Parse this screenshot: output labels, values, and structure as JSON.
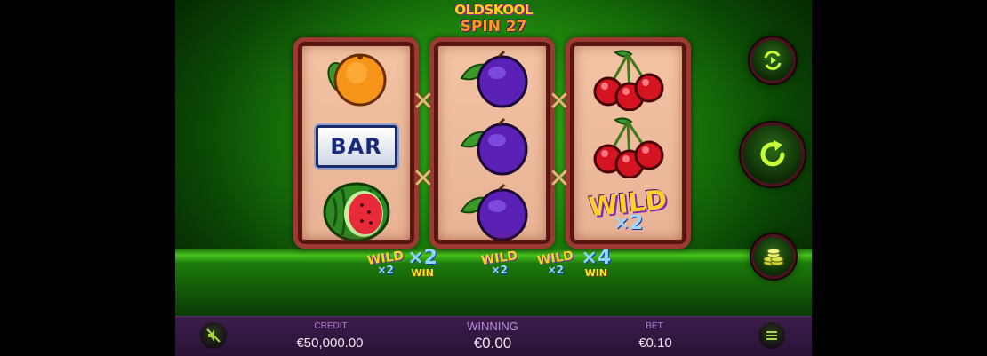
{
  "logo": {
    "line1": "OLDSKOOL",
    "line2": "SPIN 27"
  },
  "reels": [
    {
      "symbols": [
        "orange",
        "bar",
        "watermelon"
      ]
    },
    {
      "symbols": [
        "plum",
        "plum",
        "plum"
      ]
    },
    {
      "symbols": [
        "cherries",
        "cherries",
        "wild"
      ]
    }
  ],
  "symbols": {
    "bar_text": "BAR",
    "wild_text": "WILD",
    "wild_multiplier": "×2"
  },
  "bonus": {
    "left": {
      "wild_text": "WILD",
      "wild_mult": "×2",
      "multiplier": "×2",
      "win_text": "WIN"
    },
    "right": {
      "wild_text": "WILD",
      "wild_mult": "×2",
      "wild2_text": "WILD",
      "wild2_mult": "×2",
      "multiplier": "×4",
      "win_text": "WIN"
    }
  },
  "buttons": {
    "autoplay_icon": "autoplay-icon",
    "spin_icon": "spin-icon",
    "bet_icon": "coins-icon",
    "sound_icon": "sound-muted-icon",
    "menu_icon": "menu-icon"
  },
  "bottom_bar": {
    "credit_label": "CREDIT",
    "credit_value": "€50,000.00",
    "winning_label": "WINNING",
    "winning_value": "€0.00",
    "bet_label": "BET",
    "bet_value": "€0.10"
  },
  "colors": {
    "accent_green": "#3fb81c",
    "reel_frame": "#9b3a32",
    "bar_background": "#2a1236",
    "label_purple": "#b07ad8"
  }
}
